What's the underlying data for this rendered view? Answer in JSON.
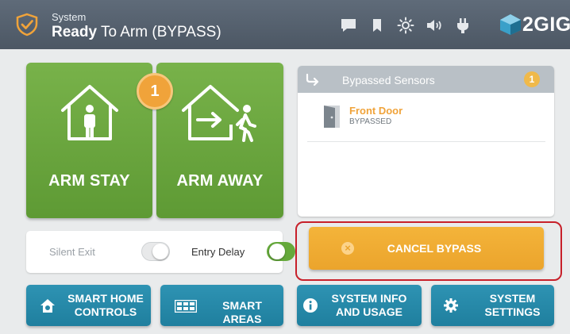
{
  "header": {
    "subtitle": "System",
    "status_bold": "Ready",
    "status_rest": " To Arm (BYPASS)",
    "icons": [
      "chat-icon",
      "bookmark-icon",
      "brightness-icon",
      "volume-icon",
      "power-plug-icon"
    ],
    "brand": "2GIG"
  },
  "arm": {
    "stay_label": "ARM STAY",
    "away_label": "ARM AWAY",
    "badge_count": "1"
  },
  "options": {
    "silent_exit_label": "Silent Exit",
    "silent_exit_on": false,
    "entry_delay_label": "Entry Delay",
    "entry_delay_on": true
  },
  "bypassed_panel": {
    "title": "Bypassed Sensors",
    "count": "1",
    "sensors": [
      {
        "name": "Front Door",
        "status": "BYPASSED"
      }
    ]
  },
  "cancel": {
    "label": "CANCEL BYPASS",
    "icon": "x-circle-icon"
  },
  "bottom_buttons": [
    {
      "label": "SMART HOME\nCONTROLS",
      "icon": "home-gear-icon"
    },
    {
      "label": "SMART AREAS",
      "icon": "areas-grid-icon"
    },
    {
      "label": "SYSTEM INFO\nAND USAGE",
      "icon": "info-icon"
    },
    {
      "label": "SYSTEM\nSETTINGS",
      "icon": "gear-icon"
    }
  ],
  "colors": {
    "header": "#56616e",
    "arm_green": "#6aa63e",
    "accent_orange": "#f0a33a",
    "button_blue": "#2a8aaa",
    "highlight_red": "#c7202a"
  }
}
